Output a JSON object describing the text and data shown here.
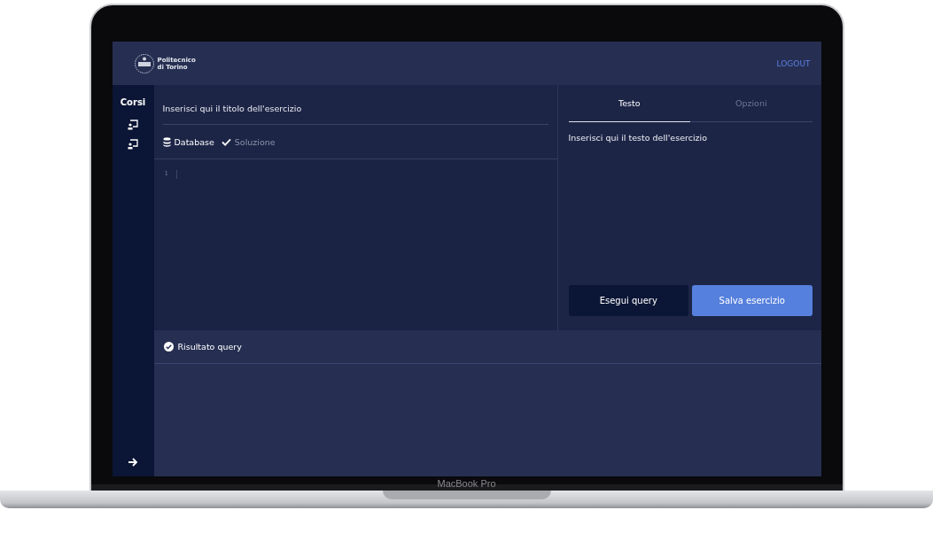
{
  "header": {
    "logo_lines": [
      "Politecnico",
      "di Torino"
    ],
    "logout": "LOGOUT"
  },
  "sidebar": {
    "title": "Corsi"
  },
  "editor": {
    "title": {
      "placeholder": "Inserisci qui il titolo dell'esercizio"
    },
    "tabs": [
      {
        "label": "Database",
        "kind": "database",
        "selected": true
      },
      {
        "label": "Soluzione",
        "kind": "check",
        "selected": false
      }
    ],
    "line_numbers": [
      "1"
    ]
  },
  "panel": {
    "tabs": [
      {
        "label": "Testo",
        "selected": true
      },
      {
        "label": "Opzioni",
        "selected": false
      }
    ],
    "text": {
      "placeholder": "Inserisci qui il testo dell'esercizio"
    },
    "buttons": [
      {
        "label": "Esegui query",
        "kind": "secondary"
      },
      {
        "label": "Salva esercizio",
        "kind": "primary"
      }
    ]
  },
  "result": {
    "title": "Risultato query"
  },
  "device_label": "MacBook Pro"
}
